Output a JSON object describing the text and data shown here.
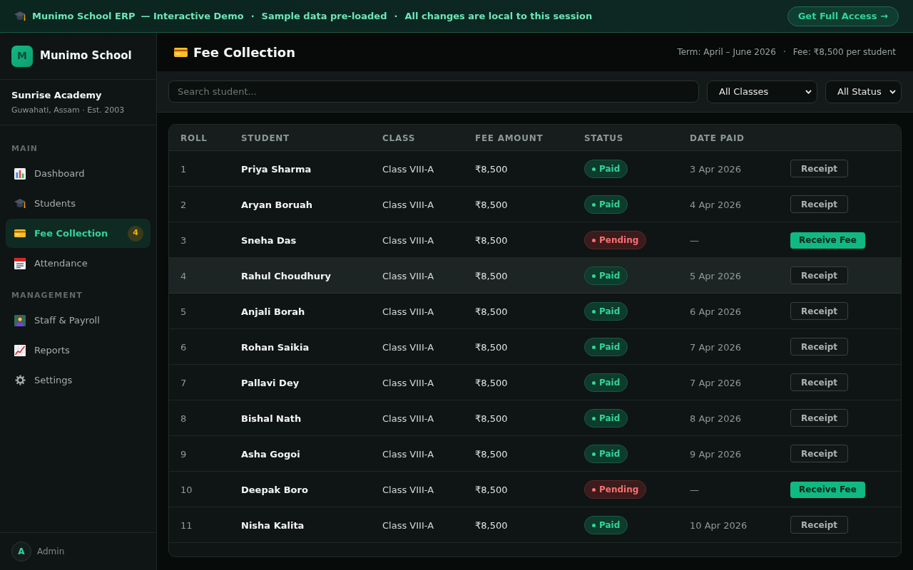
{
  "banner": {
    "product": "Munimo School ERP",
    "tagline": "— Interactive Demo",
    "separators": [
      "·",
      "·"
    ],
    "notes": [
      "Sample data pre-loaded",
      "All changes are local to this session"
    ],
    "cta": "Get Full Access →"
  },
  "sidebar": {
    "logo": {
      "mark": "M",
      "name": "Munimo School"
    },
    "school": {
      "name": "Sunrise Academy",
      "details": "Guwahati, Assam · Est. 2003"
    },
    "sections": [
      {
        "title": "MAIN",
        "items": [
          {
            "label": "Dashboard",
            "selected": false
          },
          {
            "label": "Students",
            "selected": false
          },
          {
            "label": "Fee Collection",
            "selected": true,
            "badge": "4"
          },
          {
            "label": "Attendance",
            "selected": false
          }
        ]
      },
      {
        "title": "MANAGEMENT",
        "items": [
          {
            "label": "Staff & Payroll",
            "selected": false
          },
          {
            "label": "Reports",
            "selected": false
          },
          {
            "label": "Settings",
            "selected": false
          }
        ]
      }
    ],
    "user": {
      "initial": "A",
      "name": "Admin"
    }
  },
  "page": {
    "title": "Fee Collection",
    "meta": {
      "term": "Term: April – June 2026",
      "separator": "·",
      "fee": "Fee: ₹8,500 per student"
    }
  },
  "filters": {
    "search": {
      "placeholder": "Search student..."
    },
    "class_filter": "All Classes",
    "status_filter": "All Status"
  },
  "table": {
    "columns": [
      "ROLL",
      "STUDENT",
      "CLASS",
      "FEE AMOUNT",
      "STATUS",
      "DATE PAID"
    ],
    "rows": [
      {
        "roll": "1",
        "student": "Priya Sharma",
        "class": "Class VIII-A",
        "fee": "₹8,500",
        "status": {
          "kind": "paid",
          "label": "Paid"
        },
        "date_paid": "3 Apr 2026",
        "action": {
          "kind": "receipt",
          "label": "Receipt"
        },
        "hovered": false
      },
      {
        "roll": "2",
        "student": "Aryan Boruah",
        "class": "Class VIII-A",
        "fee": "₹8,500",
        "status": {
          "kind": "paid",
          "label": "Paid"
        },
        "date_paid": "4 Apr 2026",
        "action": {
          "kind": "receipt",
          "label": "Receipt"
        },
        "hovered": false
      },
      {
        "roll": "3",
        "student": "Sneha Das",
        "class": "Class VIII-A",
        "fee": "₹8,500",
        "status": {
          "kind": "pending",
          "label": "Pending"
        },
        "date_paid": "—",
        "action": {
          "kind": "receive",
          "label": "Receive Fee"
        },
        "hovered": false
      },
      {
        "roll": "4",
        "student": "Rahul Choudhury",
        "class": "Class VIII-A",
        "fee": "₹8,500",
        "status": {
          "kind": "paid",
          "label": "Paid"
        },
        "date_paid": "5 Apr 2026",
        "action": {
          "kind": "receipt",
          "label": "Receipt"
        },
        "hovered": true
      },
      {
        "roll": "5",
        "student": "Anjali Borah",
        "class": "Class VIII-A",
        "fee": "₹8,500",
        "status": {
          "kind": "paid",
          "label": "Paid"
        },
        "date_paid": "6 Apr 2026",
        "action": {
          "kind": "receipt",
          "label": "Receipt"
        },
        "hovered": false
      },
      {
        "roll": "6",
        "student": "Rohan Saikia",
        "class": "Class VIII-A",
        "fee": "₹8,500",
        "status": {
          "kind": "paid",
          "label": "Paid"
        },
        "date_paid": "7 Apr 2026",
        "action": {
          "kind": "receipt",
          "label": "Receipt"
        },
        "hovered": false
      },
      {
        "roll": "7",
        "student": "Pallavi Dey",
        "class": "Class VIII-A",
        "fee": "₹8,500",
        "status": {
          "kind": "paid",
          "label": "Paid"
        },
        "date_paid": "7 Apr 2026",
        "action": {
          "kind": "receipt",
          "label": "Receipt"
        },
        "hovered": false
      },
      {
        "roll": "8",
        "student": "Bishal Nath",
        "class": "Class VIII-A",
        "fee": "₹8,500",
        "status": {
          "kind": "paid",
          "label": "Paid"
        },
        "date_paid": "8 Apr 2026",
        "action": {
          "kind": "receipt",
          "label": "Receipt"
        },
        "hovered": false
      },
      {
        "roll": "9",
        "student": "Asha Gogoi",
        "class": "Class VIII-A",
        "fee": "₹8,500",
        "status": {
          "kind": "paid",
          "label": "Paid"
        },
        "date_paid": "9 Apr 2026",
        "action": {
          "kind": "receipt",
          "label": "Receipt"
        },
        "hovered": false
      },
      {
        "roll": "10",
        "student": "Deepak Boro",
        "class": "Class VIII-A",
        "fee": "₹8,500",
        "status": {
          "kind": "pending",
          "label": "Pending"
        },
        "date_paid": "—",
        "action": {
          "kind": "receive",
          "label": "Receive Fee"
        },
        "hovered": false
      },
      {
        "roll": "11",
        "student": "Nisha Kalita",
        "class": "Class VIII-A",
        "fee": "₹8,500",
        "status": {
          "kind": "paid",
          "label": "Paid"
        },
        "date_paid": "10 Apr 2026",
        "action": {
          "kind": "receipt",
          "label": "Receipt"
        },
        "hovered": false
      }
    ]
  }
}
